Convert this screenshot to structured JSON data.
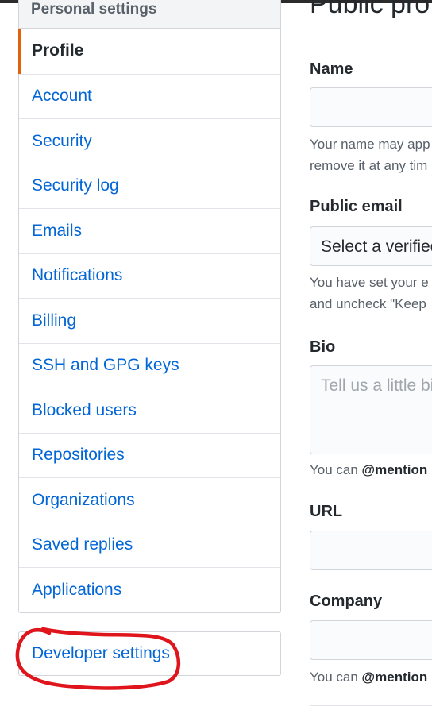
{
  "sidebar": {
    "heading": "Personal settings",
    "items": [
      {
        "label": "Profile",
        "selected": true
      },
      {
        "label": "Account"
      },
      {
        "label": "Security"
      },
      {
        "label": "Security log"
      },
      {
        "label": "Emails"
      },
      {
        "label": "Notifications"
      },
      {
        "label": "Billing"
      },
      {
        "label": "SSH and GPG keys"
      },
      {
        "label": "Blocked users"
      },
      {
        "label": "Repositories"
      },
      {
        "label": "Organizations"
      },
      {
        "label": "Saved replies"
      },
      {
        "label": "Applications"
      }
    ],
    "developer_settings": "Developer settings"
  },
  "main": {
    "title": "Public pro",
    "name_label": "Name",
    "name_note_line1": "Your name may app",
    "name_note_line2": "remove it at any tim",
    "public_email_label": "Public email",
    "public_email_value": "Select a verified",
    "public_email_note_line1": "You have set your e",
    "public_email_note_line2": "and uncheck \"Keep",
    "bio_label": "Bio",
    "bio_placeholder": "Tell us a little bi",
    "bio_note_prefix": "You can ",
    "bio_note_mention": "@mention",
    "url_label": "URL",
    "company_label": "Company",
    "company_note_prefix": "You can ",
    "company_note_mention": "@mention"
  },
  "colors": {
    "link": "#0366d6",
    "selected_accent": "#e36209",
    "annotation": "#e0151b"
  }
}
